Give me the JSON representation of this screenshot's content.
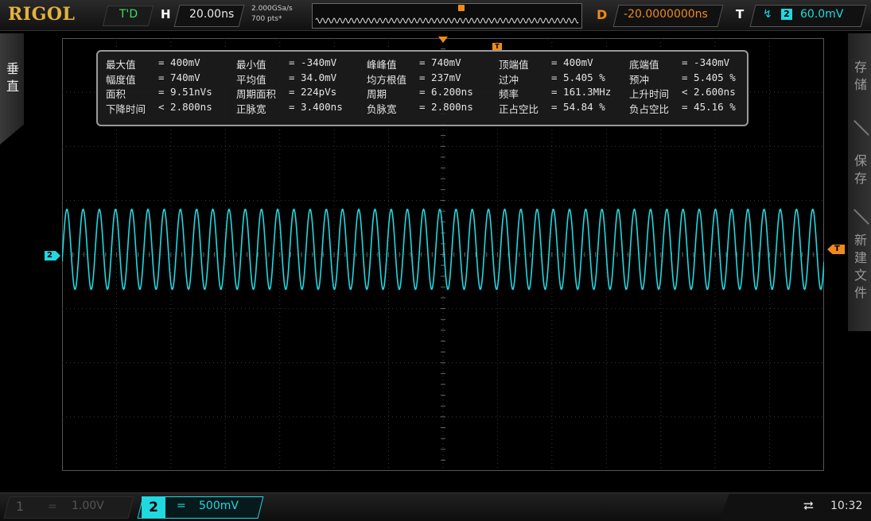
{
  "brand": "RIGOL",
  "run_state": "T'D",
  "horizontal": {
    "label": "H",
    "timebase": "20.00ns",
    "sample_rate": "2.000GSa/s",
    "memory_depth": "700  pts*"
  },
  "delay": {
    "label": "D",
    "value": "-20.0000000ns"
  },
  "trigger": {
    "label": "T",
    "edge_icon": "rising-edge-icon",
    "source": "2",
    "level": "60.0mV"
  },
  "left_tab": {
    "label": "垂直"
  },
  "right_menu": [
    {
      "label": "存储"
    },
    {
      "label": "保存"
    },
    {
      "label": "新建文件"
    }
  ],
  "markers": {
    "channel": "2",
    "trigger_level": "T",
    "trigger_pos": "T"
  },
  "measurements": [
    [
      {
        "label": "最大值",
        "value": "= 400mV"
      },
      {
        "label": "最小值",
        "value": "= -340mV"
      },
      {
        "label": "峰峰值",
        "value": "= 740mV"
      },
      {
        "label": "顶端值",
        "value": "= 400mV"
      },
      {
        "label": "底端值",
        "value": "= -340mV"
      }
    ],
    [
      {
        "label": "幅度值",
        "value": "= 740mV"
      },
      {
        "label": "平均值",
        "value": "= 34.0mV"
      },
      {
        "label": "均方根值",
        "value": "= 237mV"
      },
      {
        "label": "过冲",
        "value": "= 5.405 %"
      },
      {
        "label": "预冲",
        "value": "= 5.405 %"
      }
    ],
    [
      {
        "label": "面积",
        "value": "= 9.51nVs"
      },
      {
        "label": "周期面积",
        "value": "= 224pVs"
      },
      {
        "label": "周期",
        "value": "= 6.200ns"
      },
      {
        "label": "频率",
        "value": "= 161.3MHz"
      },
      {
        "label": "上升时间",
        "value": "< 2.600ns"
      }
    ],
    [
      {
        "label": "下降时间",
        "value": "< 2.800ns"
      },
      {
        "label": "正脉宽",
        "value": "= 3.400ns"
      },
      {
        "label": "负脉宽",
        "value": "= 2.800ns"
      },
      {
        "label": "正占空比",
        "value": "= 54.84 %"
      },
      {
        "label": "负占空比",
        "value": "= 45.16 %"
      }
    ]
  ],
  "waveform": {
    "color": "#20d8e0",
    "cycles": 47,
    "max_mv": 400,
    "min_mv": -340,
    "volts_per_div_mv": 500
  },
  "channels": [
    {
      "num": "1",
      "coupling": "=",
      "scale": "1.00V",
      "active": false
    },
    {
      "num": "2",
      "coupling": "=",
      "scale": "500mV",
      "active": true
    }
  ],
  "status": {
    "usb_icon": "usb-icon",
    "time": "10:32"
  },
  "colors": {
    "accent": "#e4b23c",
    "ch2": "#20d8e0",
    "trigger": "#f08a1c",
    "run_state": "#3ce060"
  }
}
